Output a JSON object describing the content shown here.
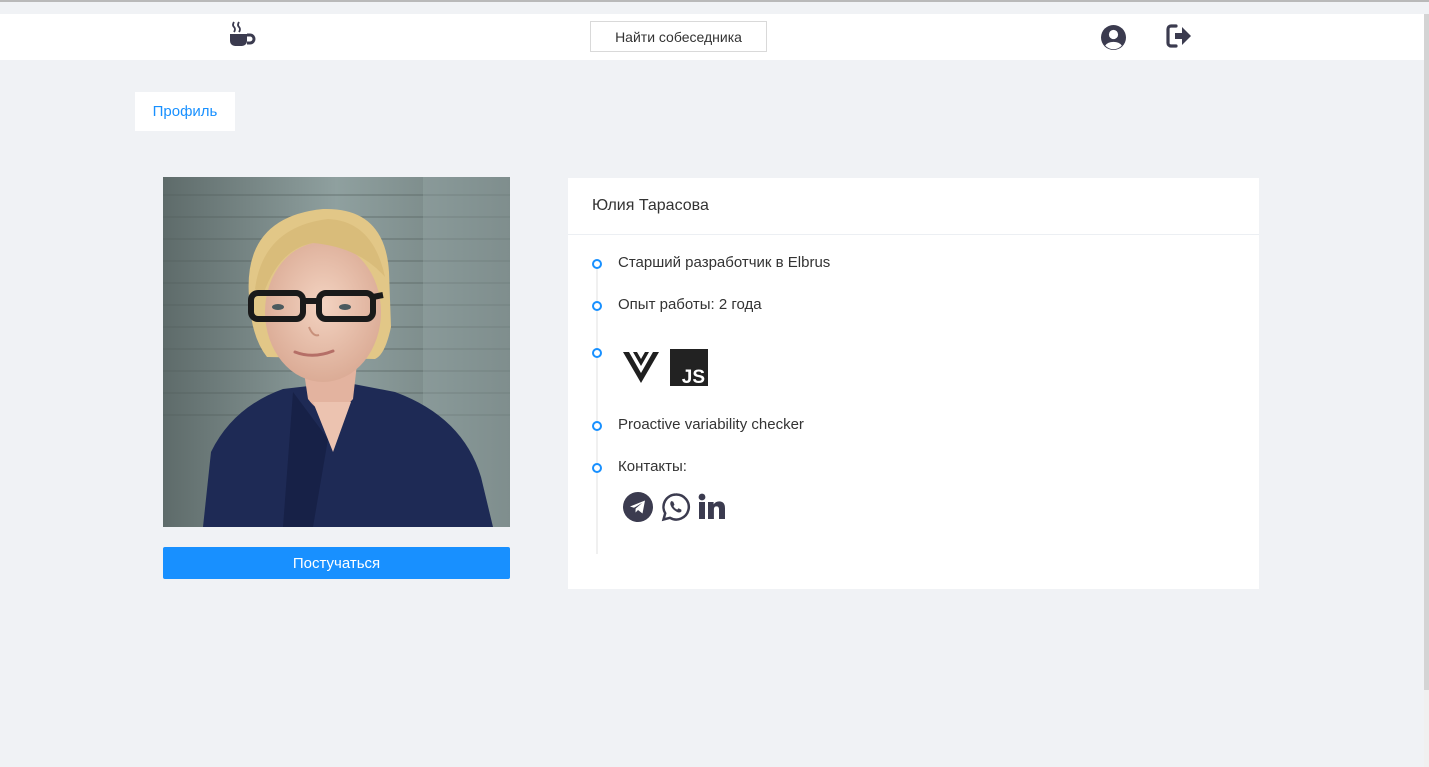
{
  "header": {
    "logo_icon": "coffee-cup-icon",
    "find_button_label": "Найти собеседника",
    "profile_icon": "user-circle-icon",
    "logout_icon": "sign-out-icon"
  },
  "tabs": {
    "profile_label": "Профиль"
  },
  "left": {
    "knock_button_label": "Постучаться",
    "photo": "portrait-photo"
  },
  "profile": {
    "name": "Юлия Тарасова",
    "items": [
      {
        "text": "Старший разработчик в Elbrus"
      },
      {
        "text": "Опыт работы: 2 года"
      },
      {
        "text": ""
      },
      {
        "text": "Proactive variability checker"
      },
      {
        "text": "Контакты:"
      }
    ],
    "tech_icons": [
      "vue-icon",
      "javascript-icon"
    ],
    "tech_js_label": "JS",
    "contact_icons": [
      "telegram-icon",
      "whatsapp-icon",
      "linkedin-icon"
    ]
  },
  "colors": {
    "accent": "#1890ff",
    "background": "#f0f2f5",
    "icon_dark": "#3b3b4f"
  }
}
